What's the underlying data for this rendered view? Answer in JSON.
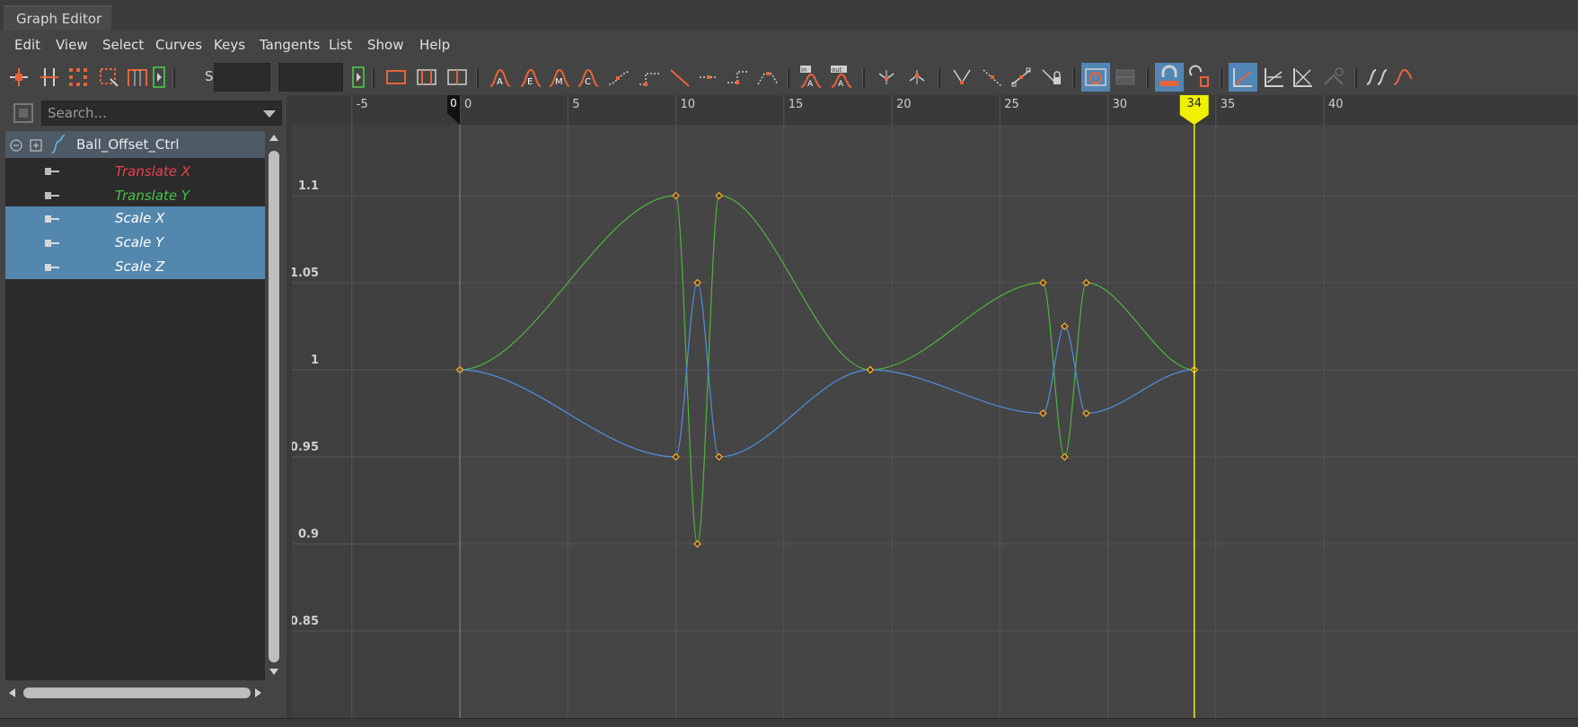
{
  "window": {
    "tab_title": "Graph Editor"
  },
  "menu": [
    "Edit",
    "View",
    "Select",
    "Curves",
    "Keys",
    "Tangents",
    "List",
    "Show",
    "Help"
  ],
  "toolbar": {
    "stats_label": "Stats",
    "stats_field_1": "",
    "stats_field_2": ""
  },
  "outliner": {
    "search_placeholder": "Search...",
    "node": {
      "name": "Ball_Offset_Ctrl"
    },
    "attributes": [
      {
        "label": "Translate X",
        "color": "#e8414a",
        "selected": false
      },
      {
        "label": "Translate Y",
        "color": "#48c048",
        "selected": false
      },
      {
        "label": "Scale X",
        "color": "#ffffff",
        "selected": true
      },
      {
        "label": "Scale Y",
        "color": "#ffffff",
        "selected": true
      },
      {
        "label": "Scale Z",
        "color": "#ffffff",
        "selected": true
      }
    ]
  },
  "graph": {
    "frame_ticks": [
      "-5",
      "0",
      "5",
      "10",
      "15",
      "20",
      "25",
      "30",
      "35",
      "40"
    ],
    "value_ticks": [
      "1.1",
      "1.05",
      "1",
      "0.95",
      "0.9",
      "0.85"
    ],
    "start_frame_label": "0",
    "current_frame": "34",
    "colors": {
      "curve_green": "#4fb53d",
      "curve_blue": "#4f8fe0",
      "key": "#f5a623",
      "current_time": "#f0f000"
    },
    "curves": [
      {
        "name": "green",
        "keys": [
          [
            0,
            1.0
          ],
          [
            10,
            1.1
          ],
          [
            11,
            0.9
          ],
          [
            12,
            1.1
          ],
          [
            19,
            1.0
          ],
          [
            27,
            1.05
          ],
          [
            28,
            0.95
          ],
          [
            29,
            1.05
          ],
          [
            34,
            1.0
          ]
        ]
      },
      {
        "name": "blue",
        "keys": [
          [
            0,
            1.0
          ],
          [
            10,
            0.95
          ],
          [
            11,
            1.05
          ],
          [
            12,
            0.95
          ],
          [
            19,
            1.0
          ],
          [
            27,
            0.975
          ],
          [
            28,
            1.025
          ],
          [
            29,
            0.975
          ],
          [
            34,
            1.0
          ]
        ]
      }
    ]
  }
}
